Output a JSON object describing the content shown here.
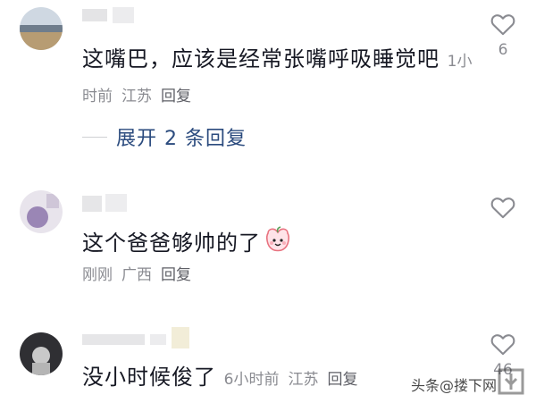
{
  "comments": [
    {
      "text": "这嘴巴，应该是经常张嘴呼吸睡觉吧",
      "time": "1小时前",
      "location": "江苏",
      "reply_label": "回复",
      "likes": "6",
      "expand_label": "展开 2 条回复"
    },
    {
      "text": "这个爸爸够帅的了",
      "time": "刚刚",
      "location": "广西",
      "reply_label": "回复",
      "likes": ""
    },
    {
      "text": "没小时候俊了",
      "time": "6小时前",
      "location": "江苏",
      "reply_label": "回复",
      "likes": "46"
    }
  ],
  "watermark": {
    "text": "头条@搂下网"
  },
  "colors": {
    "text": "#161823",
    "meta": "#8a8b91",
    "link": "#2b4b7e"
  }
}
